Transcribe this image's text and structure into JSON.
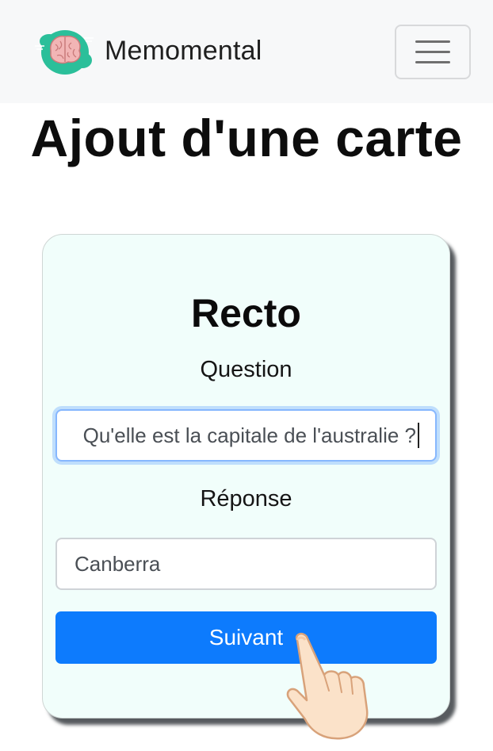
{
  "navbar": {
    "brand_name": "Memomental",
    "logo_icon": "brain-icon",
    "menu_icon": "hamburger-menu-icon"
  },
  "page": {
    "title": "Ajout d'une carte"
  },
  "card": {
    "title": "Recto",
    "question_label": "Question",
    "question_value": "Qu'elle est la capitale de l'australie ?",
    "answer_label": "Réponse",
    "answer_value": "Canberra",
    "next_button_label": "Suivant"
  },
  "overlay": {
    "pointer_icon": "tap-hand-icon"
  },
  "colors": {
    "navbar_bg": "#f7f8f9",
    "card_bg": "#f1fefb",
    "primary": "#0d7bfd",
    "focus_border": "#86b7fe"
  }
}
